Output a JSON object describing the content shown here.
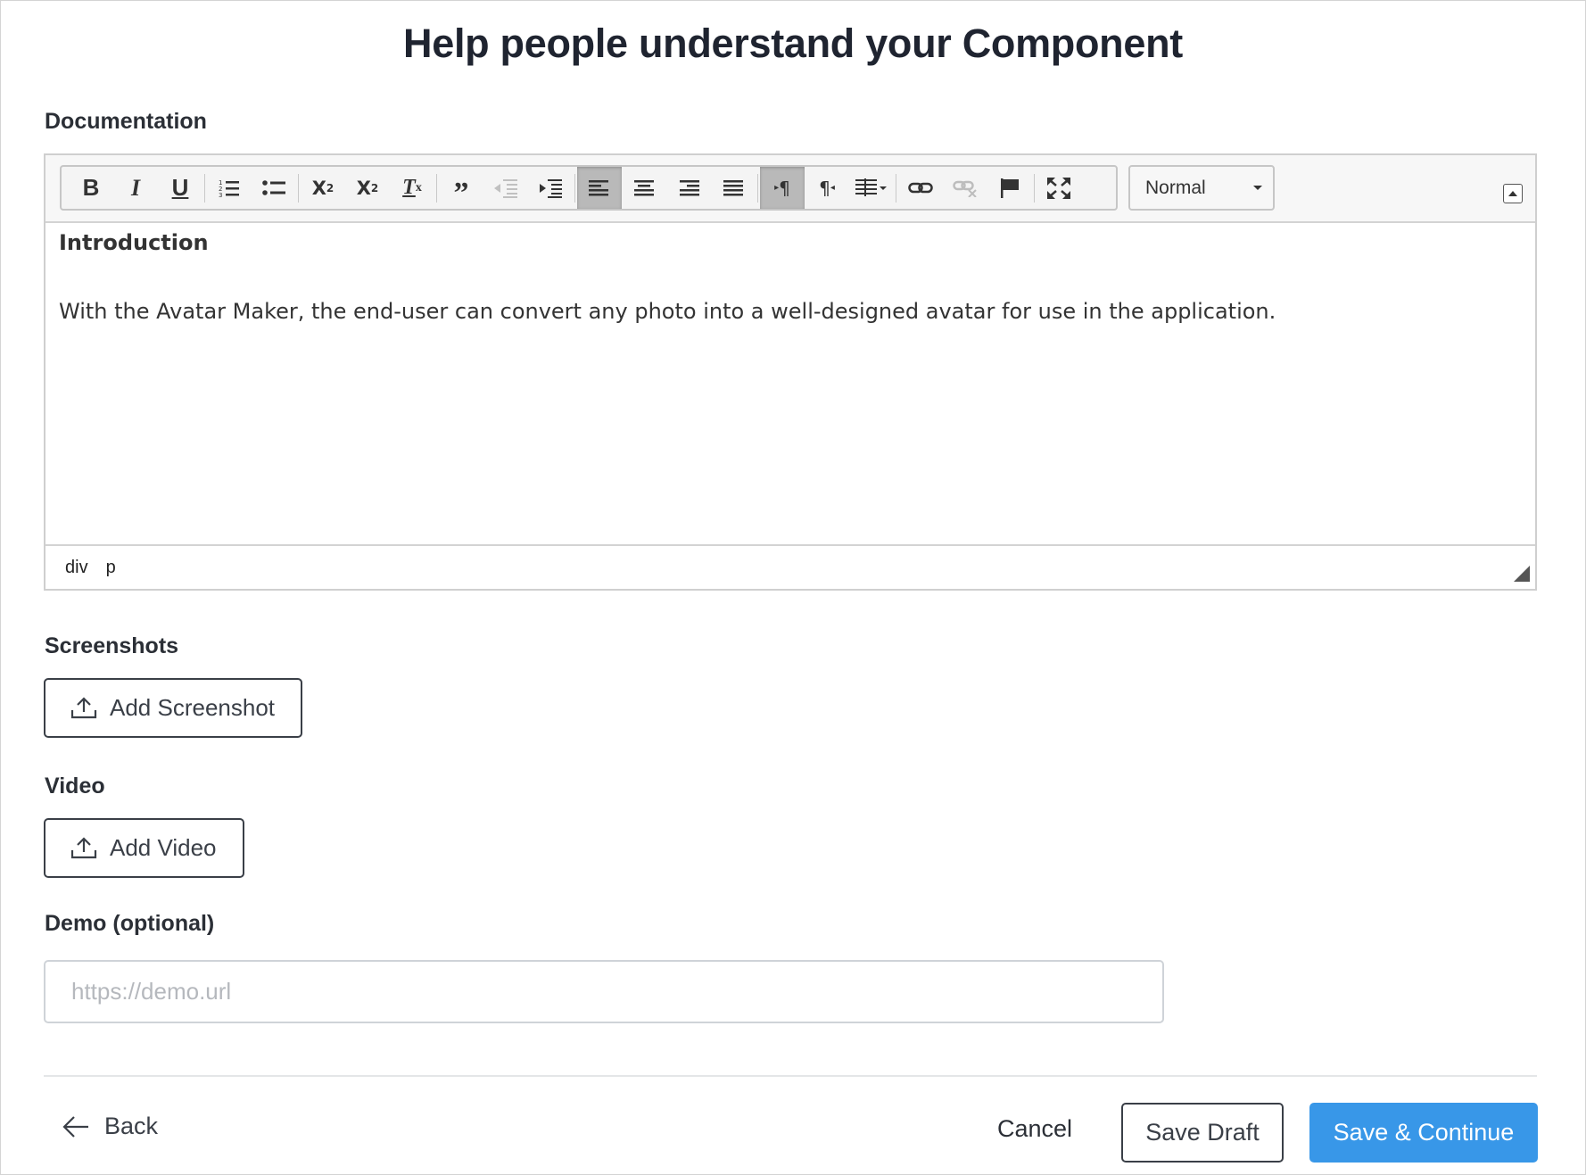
{
  "page": {
    "title": "Help people understand your Component"
  },
  "documentation": {
    "label": "Documentation",
    "toolbar": {
      "buttons": [
        {
          "name": "bold",
          "glyph": "B"
        },
        {
          "name": "italic",
          "glyph": "I"
        },
        {
          "name": "underline",
          "glyph": "U"
        },
        {
          "name": "numbered-list",
          "glyph": "numbered-list-icon"
        },
        {
          "name": "bulleted-list",
          "glyph": "bulleted-list-icon"
        },
        {
          "name": "subscript",
          "glyph": "X₂"
        },
        {
          "name": "superscript",
          "glyph": "X₂"
        },
        {
          "name": "remove-format",
          "glyph": "Tx"
        },
        {
          "name": "blockquote",
          "glyph": "❞"
        },
        {
          "name": "outdent",
          "glyph": "outdent-icon",
          "disabled": true
        },
        {
          "name": "indent",
          "glyph": "indent-icon"
        },
        {
          "name": "align-left",
          "glyph": "align-left-icon",
          "active": true
        },
        {
          "name": "align-center",
          "glyph": "align-center-icon"
        },
        {
          "name": "align-right",
          "glyph": "align-right-icon"
        },
        {
          "name": "justify",
          "glyph": "justify-icon"
        },
        {
          "name": "ltr",
          "glyph": "▸¶",
          "active": true
        },
        {
          "name": "rtl",
          "glyph": "¶◂"
        },
        {
          "name": "language",
          "glyph": "language-icon"
        },
        {
          "name": "link",
          "glyph": "link-icon"
        },
        {
          "name": "unlink",
          "glyph": "unlink-icon",
          "disabled": true
        },
        {
          "name": "anchor",
          "glyph": "flag-icon"
        },
        {
          "name": "maximize",
          "glyph": "maximize-icon"
        }
      ],
      "format_select": "Normal"
    },
    "content": {
      "heading": "Introduction",
      "paragraph": "With the Avatar Maker, the end-user can convert any photo into a well-designed avatar for use in the application."
    },
    "statusbar": {
      "path": [
        "div",
        "p"
      ]
    }
  },
  "screenshots": {
    "label": "Screenshots",
    "button": "Add Screenshot"
  },
  "video": {
    "label": "Video",
    "button": "Add Video"
  },
  "demo": {
    "label": "Demo (optional)",
    "placeholder": "https://demo.url",
    "value": ""
  },
  "footer": {
    "back": "Back",
    "cancel": "Cancel",
    "save_draft": "Save Draft",
    "save_continue": "Save & Continue"
  },
  "colors": {
    "primary": "#3897e8",
    "border_dark": "#3a3f47",
    "text": "#2b2f36"
  }
}
